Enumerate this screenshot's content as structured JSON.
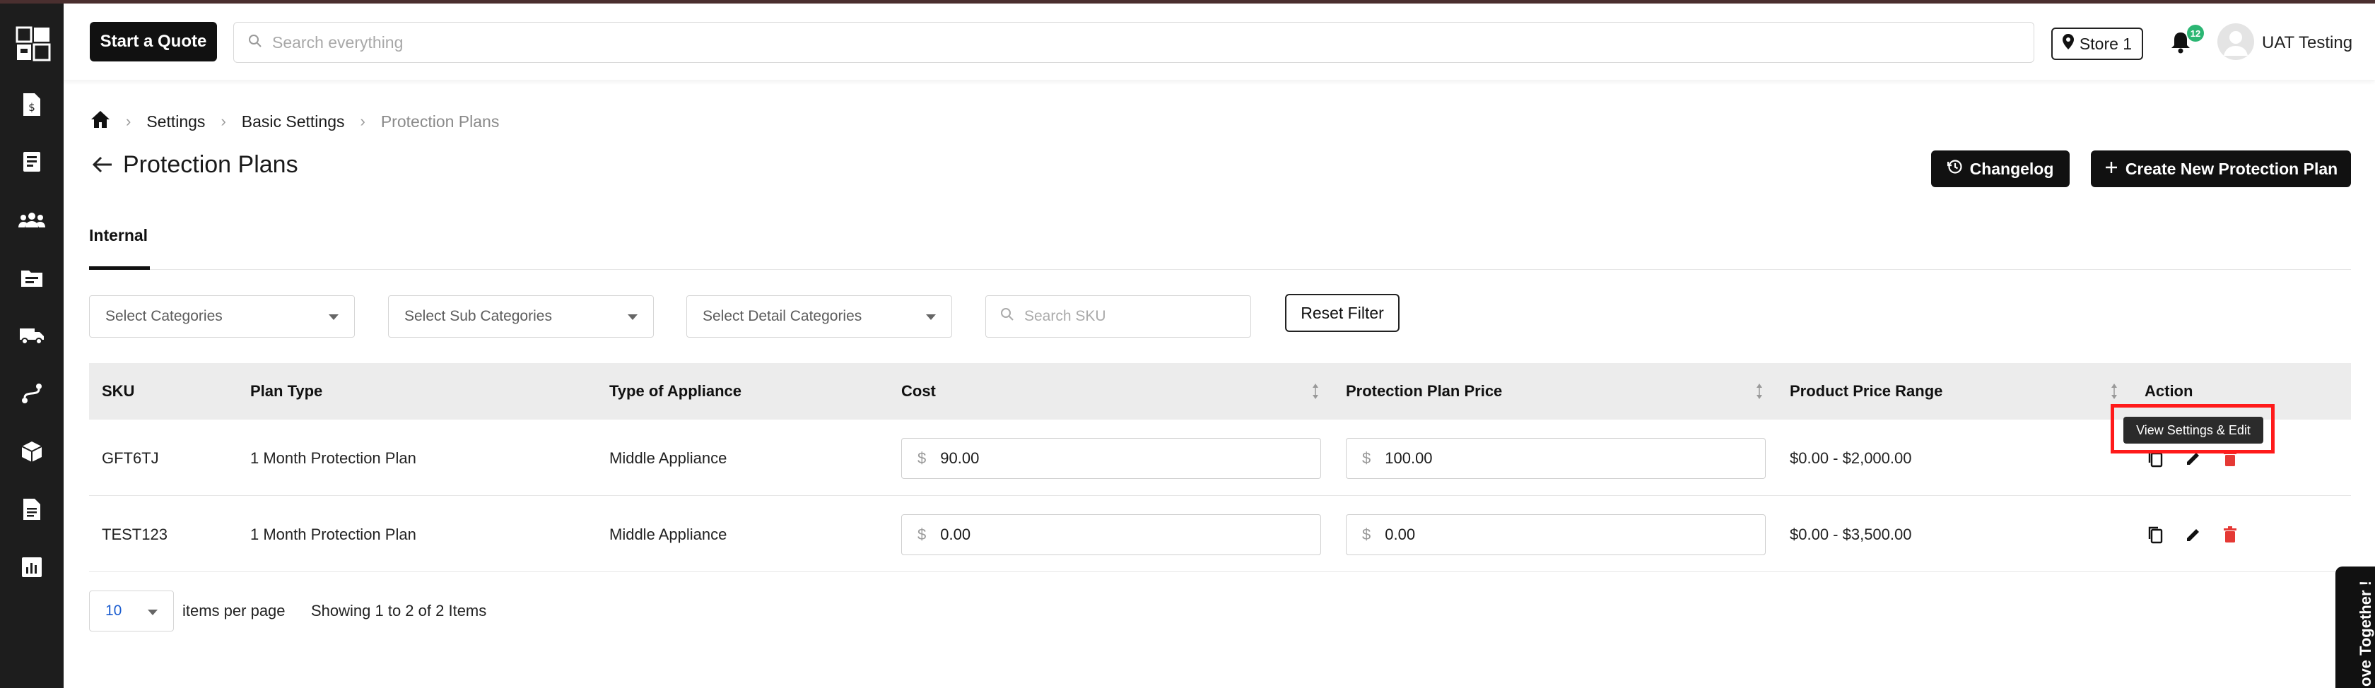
{
  "header": {
    "quote_button": "Start a Quote",
    "search_placeholder": "Search everything",
    "store": "Store 1",
    "notification_count": "12",
    "user_name": "UAT Testing"
  },
  "breadcrumb": [
    "Settings",
    "Basic Settings",
    "Protection Plans"
  ],
  "page": {
    "title": "Protection Plans",
    "changelog_button": "Changelog",
    "create_button": "Create New Protection Plan"
  },
  "tabs": [
    {
      "label": "Internal",
      "active": true
    }
  ],
  "filters": {
    "categories": "Select Categories",
    "sub_categories": "Select Sub Categories",
    "detail_categories": "Select Detail Categories",
    "sku_placeholder": "Search SKU",
    "reset": "Reset Filter"
  },
  "table": {
    "columns": [
      "SKU",
      "Plan Type",
      "Type of Appliance",
      "Cost",
      "Protection Plan Price",
      "Product Price Range",
      "Action"
    ],
    "currency_symbol": "$",
    "rows": [
      {
        "sku": "GFT6TJ",
        "plan_type": "1 Month Protection Plan",
        "appliance": "Middle Appliance",
        "cost": "90.00",
        "price": "100.00",
        "range": "$0.00 - $2,000.00"
      },
      {
        "sku": "TEST123",
        "plan_type": "1 Month Protection Plan",
        "appliance": "Middle Appliance",
        "cost": "0.00",
        "price": "0.00",
        "range": "$0.00 - $3,500.00"
      }
    ]
  },
  "tooltip": "View Settings & Edit",
  "pagination": {
    "per_page": "10",
    "per_page_label": "items per page",
    "info": "Showing 1 to 2 of 2 Items"
  },
  "side_banner": "ove Together !",
  "colors": {
    "primary": "#111111",
    "delete": "#e53935",
    "badge": "#2bb673",
    "highlight": "#ff1a1a"
  }
}
